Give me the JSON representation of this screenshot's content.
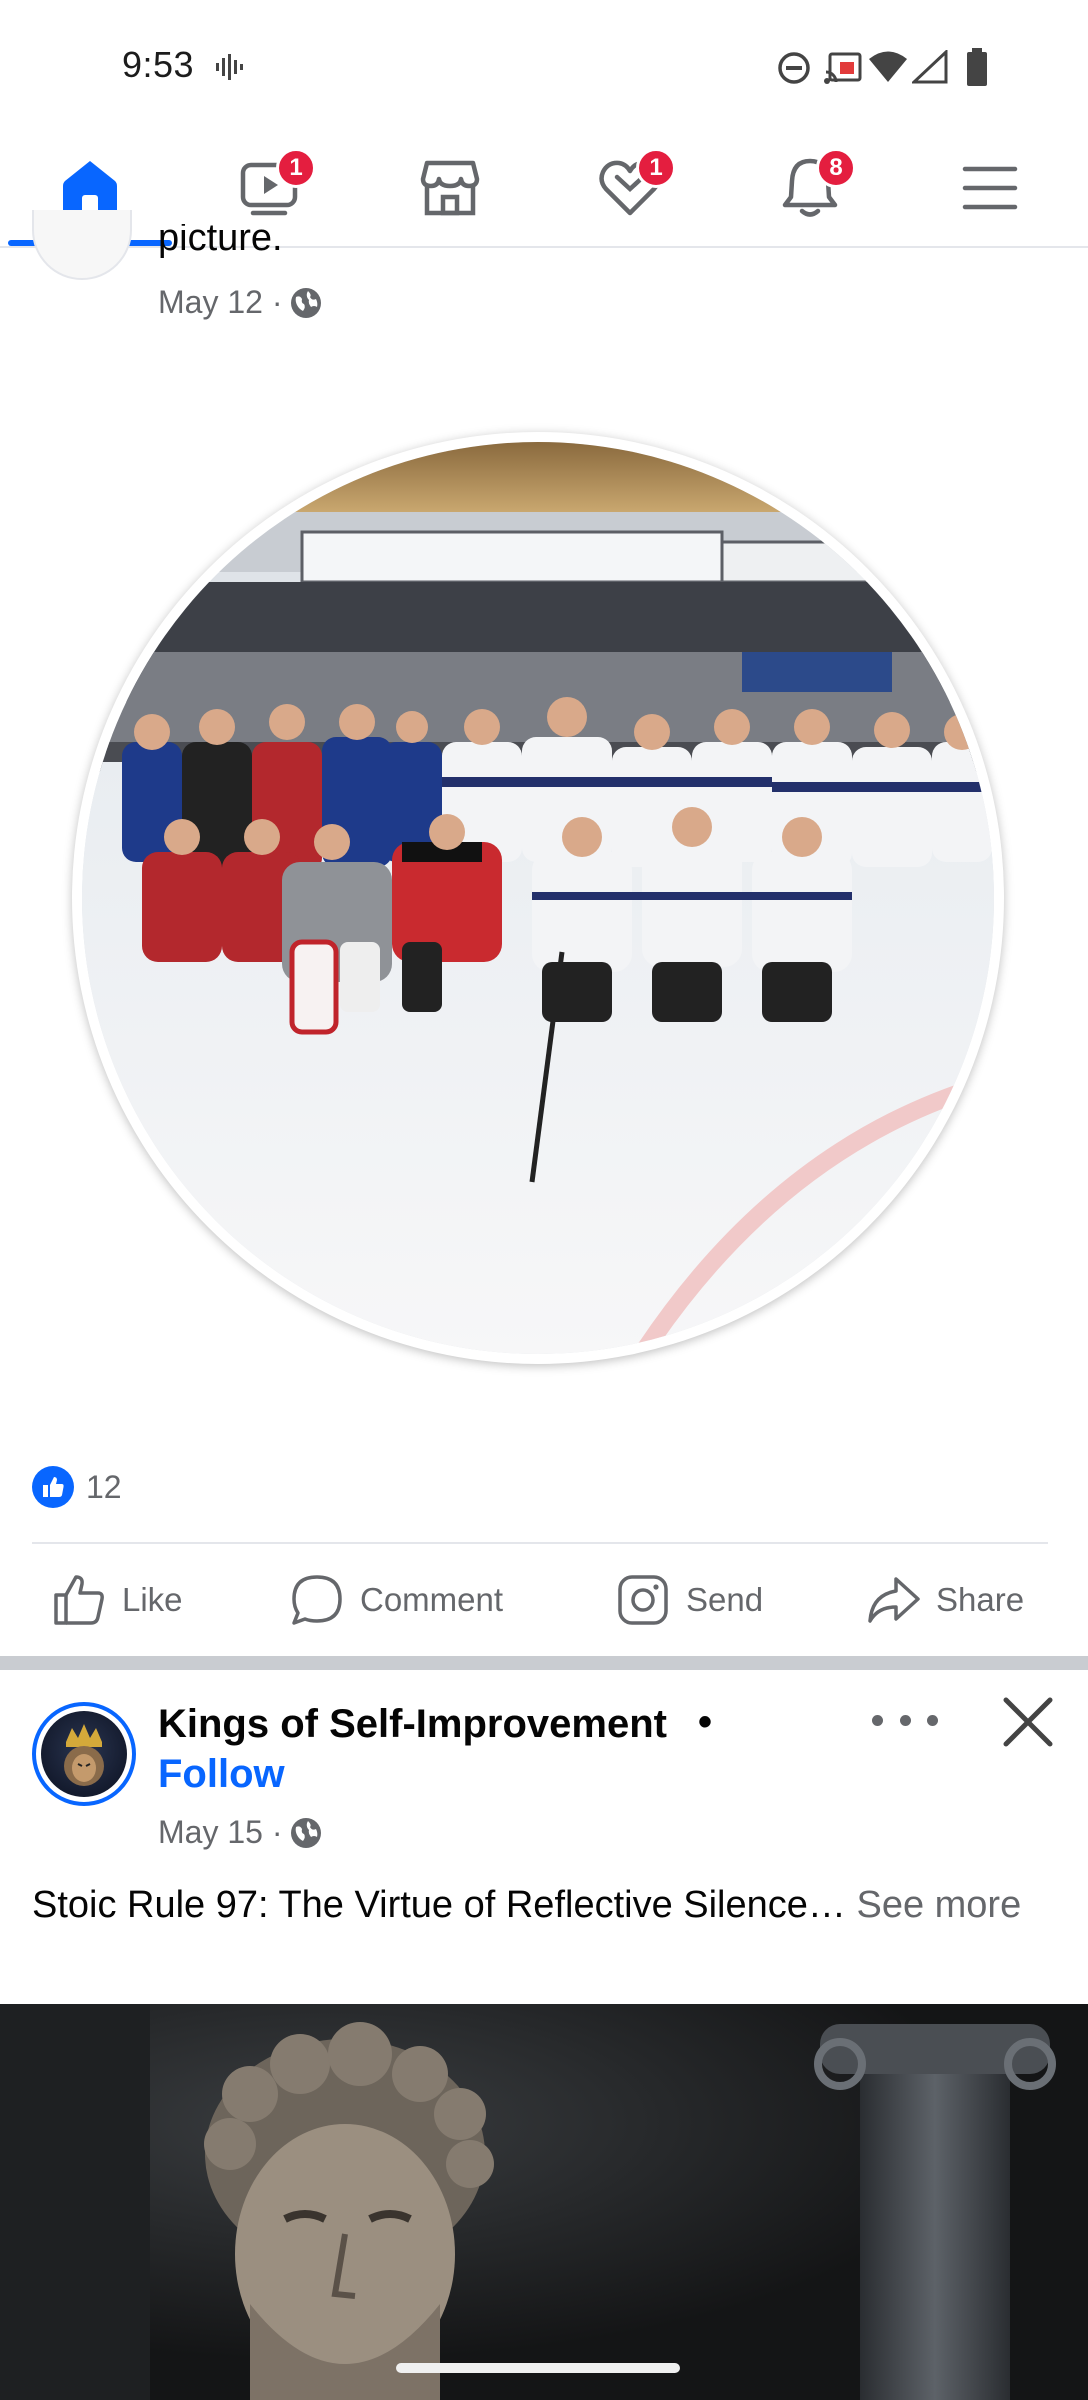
{
  "status_bar": {
    "time": "9:53"
  },
  "nav": {
    "items": [
      {
        "name": "home",
        "icon": "home-icon",
        "active": true,
        "badge": ""
      },
      {
        "name": "video",
        "icon": "video-icon",
        "active": false,
        "badge": "1"
      },
      {
        "name": "marketplace",
        "icon": "marketplace-icon",
        "active": false,
        "badge": ""
      },
      {
        "name": "dating",
        "icon": "heart-icon",
        "active": false,
        "badge": "1"
      },
      {
        "name": "notifications",
        "icon": "bell-icon",
        "active": false,
        "badge": "8"
      },
      {
        "name": "menu",
        "icon": "menu-icon",
        "active": false,
        "badge": ""
      }
    ],
    "accent": "#0866ff",
    "badge_color": "#e41e3f"
  },
  "post1": {
    "caption_tail": "picture.",
    "date": "May 12 ·",
    "audience_icon": "globe-icon",
    "reaction_count": "12",
    "actions": {
      "like": "Like",
      "comment": "Comment",
      "send": "Send",
      "share": "Share"
    }
  },
  "post2": {
    "page_name": "Kings of Self-Improvement",
    "separator": "•",
    "follow": "Follow",
    "date": "May 15 ·",
    "audience_icon": "globe-icon",
    "text": "Stoic Rule 97: The Virtue of Reflective Silence…",
    "see_more": "See more"
  }
}
